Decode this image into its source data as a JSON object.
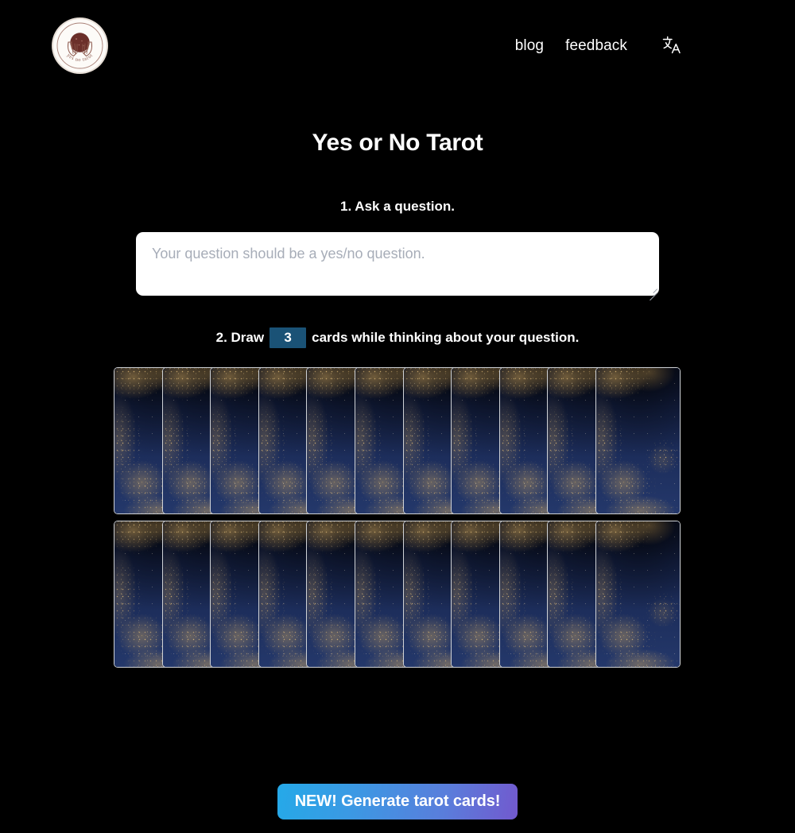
{
  "site": {
    "logo_alt": "yes no tarot",
    "logo_text": "yes no tarot"
  },
  "header": {
    "nav": [
      {
        "label": "blog",
        "name": "nav-link-blog"
      },
      {
        "label": "feedback",
        "name": "nav-link-feedback"
      }
    ],
    "language_icon": "translate-icon",
    "language_glyph": "文A"
  },
  "main": {
    "title": "Yes or No Tarot",
    "step1": {
      "label": "1. Ask a question.",
      "question_value": "",
      "question_placeholder": "Your question should be a yes/no question."
    },
    "step2": {
      "text_before": "2. Draw",
      "card_count": "3",
      "text_after": "cards while thinking about your question."
    }
  },
  "deck": {
    "rows": 2,
    "cards_per_row": 11,
    "card_back_name": "tarot-card-back",
    "colors": {
      "card_navy": "#16244f",
      "card_gold": "#c69e58",
      "card_border": "#cfd2d6"
    }
  },
  "footer": {
    "cta_label": "NEW! Generate tarot cards!",
    "cta_gradient_from": "#25a9e8",
    "cta_gradient_to": "#7259ce"
  },
  "theme": {
    "background": "#000000",
    "text": "#ffffff",
    "accent_blue": "#1a5276",
    "placeholder": "#a7adb8"
  }
}
